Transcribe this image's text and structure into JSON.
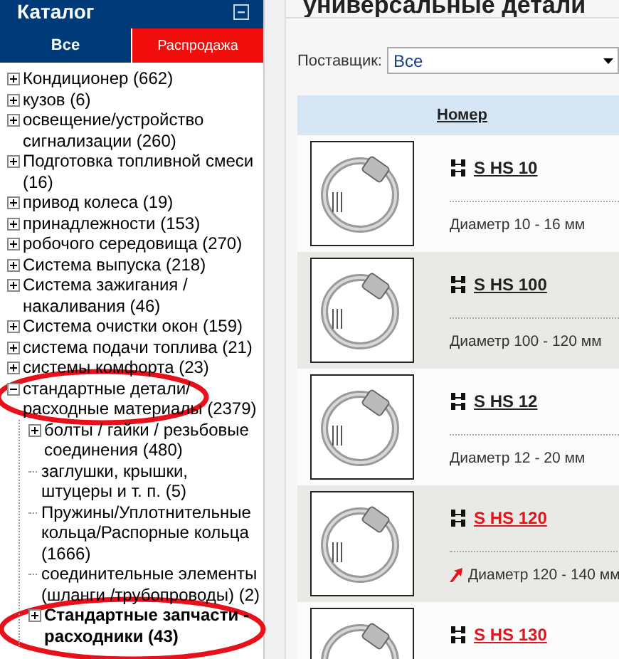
{
  "catalog": {
    "title": "Каталог",
    "tabs": [
      {
        "label": "Все",
        "selected": true
      },
      {
        "label": "Распродажа",
        "selected": false
      }
    ],
    "tree": [
      {
        "label": "Кондиционер (662)",
        "expanded": false,
        "selected": false
      },
      {
        "label": "кузов (6)",
        "expanded": false,
        "selected": false
      },
      {
        "label": "освещение/устройство сигнализации (260)",
        "expanded": false,
        "selected": false
      },
      {
        "label": "Подготовка топливной смеси (16)",
        "expanded": false,
        "selected": false
      },
      {
        "label": "привод колеса (19)",
        "expanded": false,
        "selected": false
      },
      {
        "label": "принадлежности (153)",
        "expanded": false,
        "selected": false
      },
      {
        "label": "робочого середовища (270)",
        "expanded": false,
        "selected": false
      },
      {
        "label": "Система выпуска (218)",
        "expanded": false,
        "selected": false
      },
      {
        "label": "Система зажигания / накаливания (46)",
        "expanded": false,
        "selected": false
      },
      {
        "label": "Система очистки окон (159)",
        "expanded": false,
        "selected": false
      },
      {
        "label": "система подачи топлива (21)",
        "expanded": false,
        "selected": false
      },
      {
        "label": "системы комфорта (23)",
        "expanded": false,
        "selected": false
      },
      {
        "label": "стандартные детали/ расходные материалы (2379)",
        "expanded": true,
        "selected": false,
        "children": [
          {
            "label": "болты / гайки / резьбовые соединения (480)",
            "expanded": false,
            "selected": false
          },
          {
            "label": "заглушки, крышки, штуцеры и т. п. (5)",
            "selected": false
          },
          {
            "label": "Пружины/Уплотнительные кольца/Распорные кольца (1666)",
            "selected": false
          },
          {
            "label": "соединительные элементы (шланги /трубопроводы) (2)",
            "selected": false
          },
          {
            "label": "Стандартные запчасти - расходники (43)",
            "expanded": false,
            "selected": true
          }
        ]
      }
    ]
  },
  "main": {
    "title": "универсальные детали",
    "supplier": {
      "label": "Поставщик:",
      "value": "Все"
    },
    "table": {
      "columns": [
        "Номер"
      ],
      "rows": [
        {
          "number": "S HS 10",
          "description": "Диаметр 10 - 16 мм",
          "highlighted": false
        },
        {
          "number": "S HS 100",
          "description": "Диаметр 100 - 120 мм",
          "highlighted": false
        },
        {
          "number": "S HS 12",
          "description": "Диаметр 12 - 20 мм",
          "highlighted": false
        },
        {
          "number": "S HS 120",
          "description": "Диаметр 120 - 140 мм",
          "highlighted": true
        },
        {
          "number": "S HS 130",
          "highlighted": true
        }
      ]
    }
  }
}
